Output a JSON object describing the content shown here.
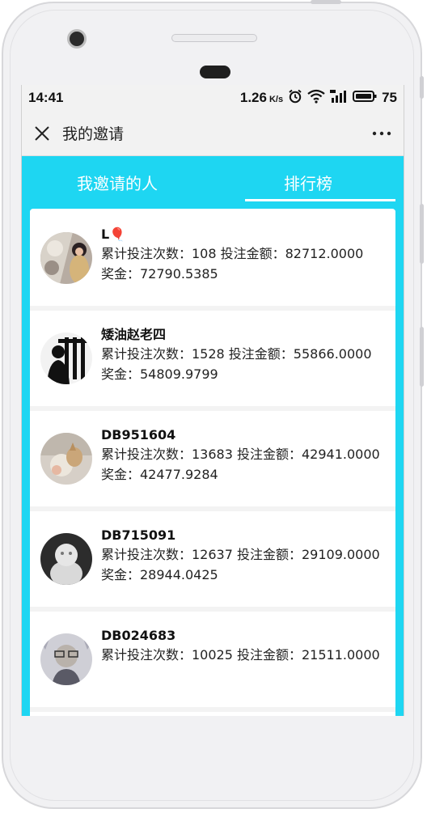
{
  "status": {
    "time": "14:41",
    "speed": "1.26",
    "speed_unit": "K/s",
    "battery": "75"
  },
  "header": {
    "title": "我的邀请"
  },
  "tabs": [
    {
      "label": "我邀请的人"
    },
    {
      "label": "排行榜"
    }
  ],
  "leaderboard": [
    {
      "name": "L🎈",
      "bets": "累计投注次数：108 投注金额：82712.0000",
      "bonus": "奖金：72790.5385"
    },
    {
      "name": "矮油赵老四",
      "bets": "累计投注次数：1528 投注金额：55866.0000",
      "bonus": "奖金：54809.9799"
    },
    {
      "name": "DB951604",
      "bets": "累计投注次数：13683 投注金额：42941.0000",
      "bonus": "奖金：42477.9284"
    },
    {
      "name": "DB715091",
      "bets": "累计投注次数：12637 投注金额：29109.0000",
      "bonus": "奖金：28944.0425"
    },
    {
      "name": "DB024683",
      "bets": "累计投注次数：10025 投注金额：21511.0000",
      "bonus": ""
    }
  ],
  "colors": {
    "accent": "#1ed6f2",
    "background": "#f2f2f2"
  }
}
